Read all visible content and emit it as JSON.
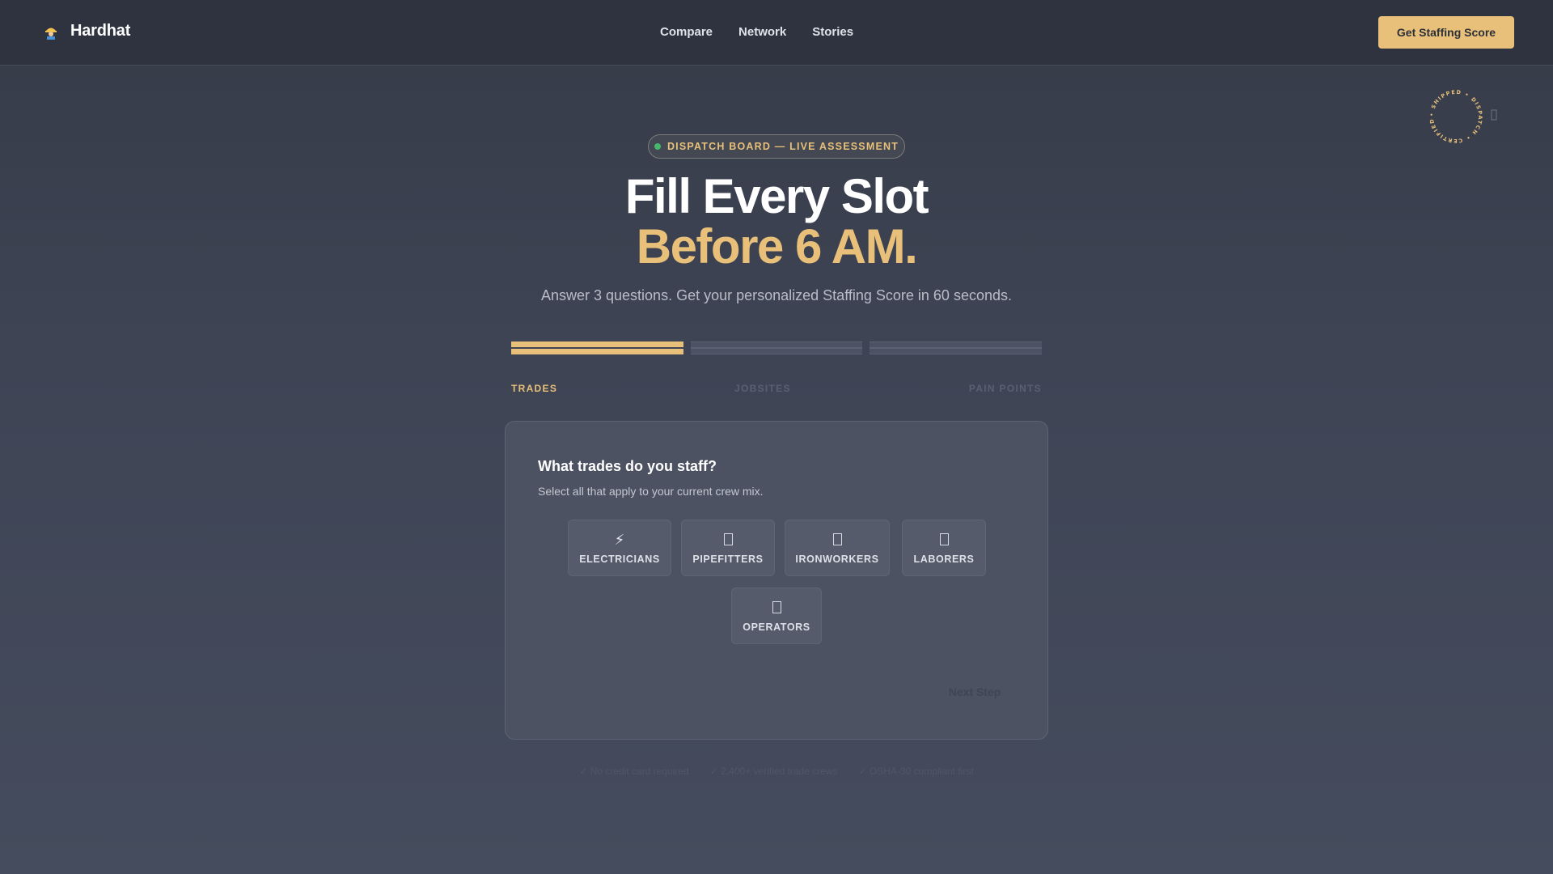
{
  "header": {
    "brand": "Hardhat",
    "brand_icon": "construction-worker-icon",
    "nav": [
      "Compare",
      "Network",
      "Stories"
    ],
    "cta_label": "Get Staffing Score"
  },
  "stamp": {
    "text": "• SHIPPED • DISPATCH • CERTIFIED •",
    "icon": "circular-stamp-icon"
  },
  "hero": {
    "badge": "DISPATCH BOARD — LIVE ASSESSMENT",
    "headline_line1": "Fill Every Slot",
    "headline_line2": "Before 6 AM.",
    "subhead": "Answer 3 questions. Get your personalized Staffing Score in 60 seconds."
  },
  "progress": {
    "current_step": 1,
    "total_steps": 3,
    "steps": [
      "TRADES",
      "JOBSITES",
      "PAIN POINTS"
    ]
  },
  "card": {
    "title": "What trades do you staff?",
    "subtitle": "Select all that apply to your current crew mix.",
    "options": [
      {
        "label": "ELECTRICIANS",
        "icon": "lightning-bolt-icon",
        "glyph": "⚡"
      },
      {
        "label": "PIPEFITTERS",
        "icon": "pipe-icon",
        "glyph": ""
      },
      {
        "label": "IRONWORKERS",
        "icon": "beam-icon",
        "glyph": ""
      },
      {
        "label": "LABORERS",
        "icon": "shovel-icon",
        "glyph": ""
      },
      {
        "label": "OPERATORS",
        "icon": "excavator-icon",
        "glyph": ""
      }
    ],
    "next_label": "Next Step"
  },
  "trust": [
    "✓ No credit card required",
    "✓ 2,400+ verified trade crews",
    "✓ OSHA-30 compliant first"
  ],
  "colors": {
    "accent": "#e8c079",
    "background": "#3e4454",
    "live_dot": "#46b86a"
  }
}
